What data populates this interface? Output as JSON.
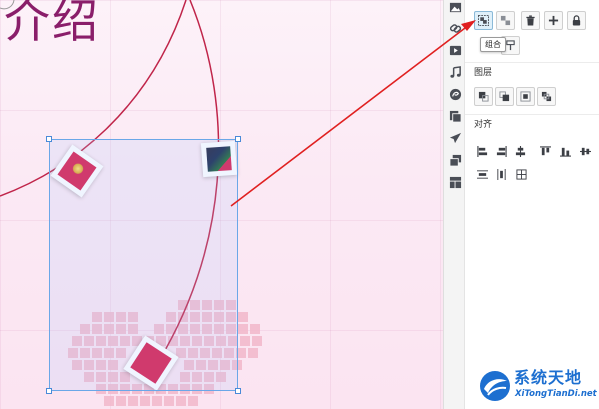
{
  "canvas": {
    "title": "介绍"
  },
  "toolbar": {
    "group_tooltip": "组合",
    "buttons": [
      {
        "name": "group",
        "icon": "group-icon",
        "active": true
      },
      {
        "name": "ungroup",
        "icon": "ungroup-icon",
        "active": false
      },
      {
        "name": "delete",
        "icon": "trash-icon",
        "active": false
      },
      {
        "name": "add",
        "icon": "plus-icon",
        "active": false
      },
      {
        "name": "lock",
        "icon": "lock-icon",
        "active": false
      },
      {
        "name": "copy-format",
        "icon": "format-icon",
        "active": false
      }
    ]
  },
  "sections": {
    "layers_label": "图层",
    "align_label": "对齐"
  },
  "icon_rail": [
    {
      "name": "image",
      "icon": "image-icon"
    },
    {
      "name": "link",
      "icon": "link-icon"
    },
    {
      "name": "video",
      "icon": "video-icon"
    },
    {
      "name": "music",
      "icon": "music-icon"
    },
    {
      "name": "effects",
      "icon": "swirl-icon"
    },
    {
      "name": "pages",
      "icon": "pages-icon"
    },
    {
      "name": "publish",
      "icon": "plane-icon"
    },
    {
      "name": "layers",
      "icon": "stack-icon"
    },
    {
      "name": "layout",
      "icon": "layout-icon"
    }
  ],
  "watermark": {
    "title": "系统天地",
    "url": "XiTongTianDi.net"
  },
  "colors": {
    "accent_red": "#e02020",
    "canvas_title": "#8a1e6a",
    "selection_border": "#6aa7e8",
    "watermark_blue": "#1d6fd0"
  }
}
